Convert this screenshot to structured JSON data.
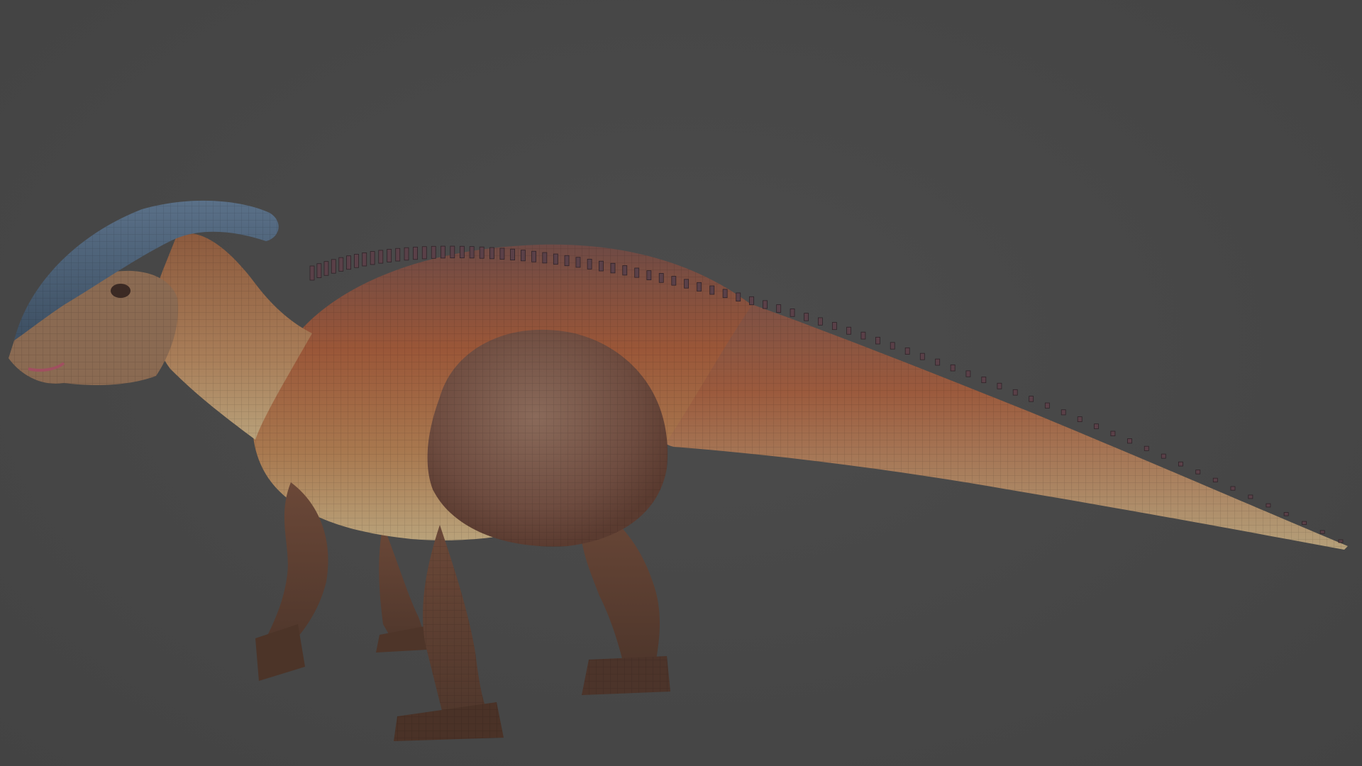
{
  "scene": {
    "subject": "parasaurolophus",
    "background_color": "#474747",
    "crest_color": "#4a5f75",
    "body_color": "#8a4f35",
    "belly_color": "#b8a27a",
    "limb_color": "#5e3f30",
    "spine_color": "#5a4048"
  }
}
